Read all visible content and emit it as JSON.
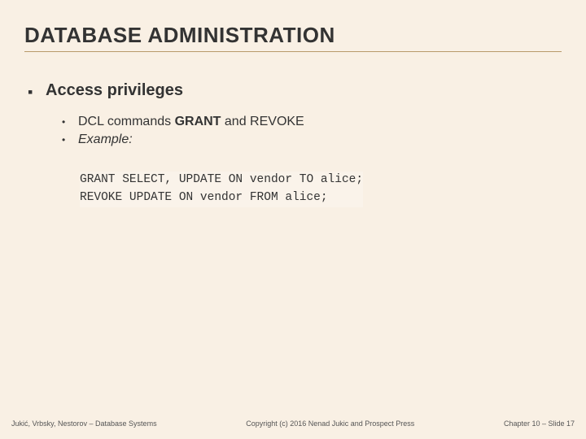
{
  "title": "DATABASE ADMINISTRATION",
  "top_bullet": "Access privileges",
  "sub1_prefix": "DCL commands ",
  "sub1_strong": "GRANT",
  "sub1_mid": " and REVOKE",
  "sub2": "Example:",
  "code_line1": "GRANT SELECT, UPDATE ON vendor TO alice;",
  "code_line2": "REVOKE UPDATE ON vendor FROM alice;",
  "footer_left": "Jukić, Vrbsky, Nestorov – Database Systems",
  "footer_center": "Copyright (c) 2016 Nenad Jukic and Prospect Press",
  "footer_right": "Chapter 10 – Slide 17"
}
